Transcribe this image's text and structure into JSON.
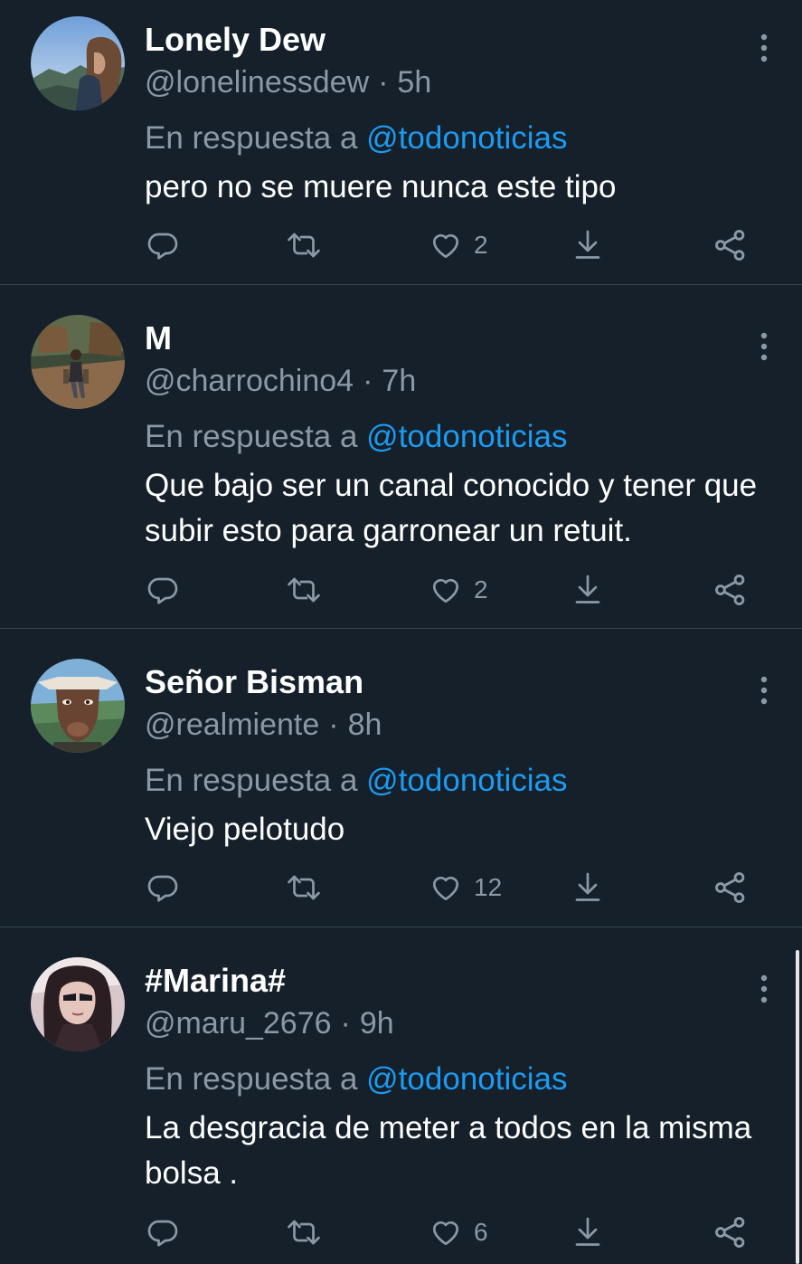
{
  "tweets": [
    {
      "name": "Lonely Dew",
      "handle": "@lonelinessdew",
      "separator": "·",
      "time": "5h",
      "reply_prefix": "En respuesta a",
      "reply_mention": "@todonoticias",
      "text": "pero no se muere nunca este tipo",
      "likes": "2"
    },
    {
      "name": "M",
      "handle": "@charrochino4",
      "separator": "·",
      "time": "7h",
      "reply_prefix": "En respuesta a",
      "reply_mention": "@todonoticias",
      "text": "Que bajo ser un canal conocido y tener que subir esto para garronear un retuit.",
      "likes": "2"
    },
    {
      "name": "Señor Bisman",
      "handle": "@realmiente",
      "separator": "·",
      "time": "8h",
      "reply_prefix": "En respuesta a",
      "reply_mention": "@todonoticias",
      "text": "Viejo pelotudo",
      "likes": "12"
    },
    {
      "name": "#Marina#",
      "handle": "@maru_2676",
      "separator": "·",
      "time": "9h",
      "reply_prefix": "En respuesta a",
      "reply_mention": "@todonoticias",
      "text": "La desgracia de meter a todos en la misma bolsa .",
      "likes": "6"
    }
  ],
  "icons": {
    "reply": "reply-icon",
    "retweet": "retweet-icon",
    "like": "heart-icon",
    "download": "download-icon",
    "share": "share-icon",
    "more": "more-options-icon"
  },
  "colors": {
    "background": "#15202b",
    "divider": "#38444d",
    "secondary_text": "#8b98a5",
    "mention": "#1d9bf0",
    "primary_text": "#ffffff"
  }
}
